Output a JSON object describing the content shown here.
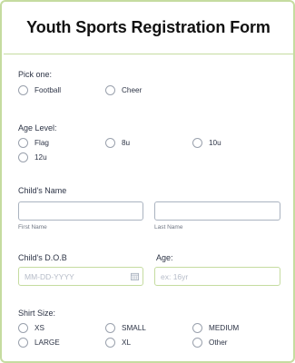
{
  "form": {
    "title": "Youth Sports Registration Form",
    "accent_color": "#c5dca0",
    "pick_one": {
      "label": "Pick one:",
      "options": [
        "Football",
        "Cheer"
      ]
    },
    "age_level": {
      "label": "Age Level:",
      "options": [
        "Flag",
        "8u",
        "10u",
        "12u"
      ]
    },
    "childs_name": {
      "label": "Child's Name",
      "first_sublabel": "First Name",
      "last_sublabel": "Last Name",
      "first_value": "",
      "last_value": ""
    },
    "dob": {
      "label": "Child's D.O.B",
      "placeholder": "MM-DD-YYYY",
      "icon": "calendar-icon"
    },
    "age": {
      "label": "Age:",
      "placeholder": "ex: 16yr"
    },
    "shirt_size": {
      "label": "Shirt Size:",
      "options": [
        "XS",
        "SMALL",
        "MEDIUM",
        "LARGE",
        "XL",
        "Other"
      ]
    }
  }
}
